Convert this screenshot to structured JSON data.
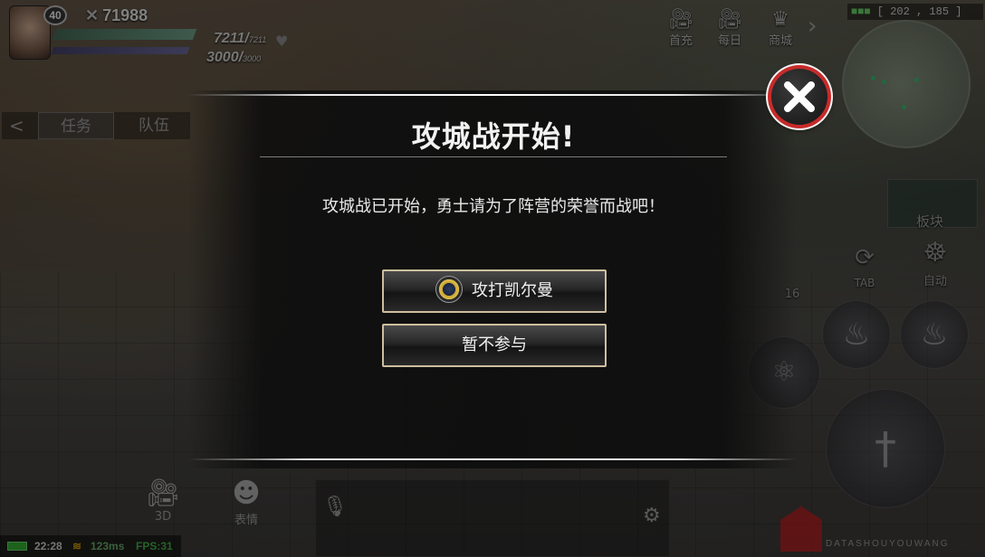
{
  "hud": {
    "level": "40",
    "combat_power": "71988",
    "hp_current": "7211",
    "hp_max": "7211",
    "mp_current": "3000",
    "mp_max": "3000"
  },
  "top_menu": {
    "items": [
      {
        "label": "首充",
        "icon": "camera-icon"
      },
      {
        "label": "每日",
        "icon": "camera-icon"
      },
      {
        "label": "商城",
        "icon": "crown-icon"
      }
    ]
  },
  "minimap": {
    "coordinates": "202 , 185"
  },
  "quest_panel": {
    "tab_task": "任务",
    "tab_team": "队伍"
  },
  "right_panel": {
    "block_label": "板块",
    "tab_label": "TAB",
    "auto_label": "自动",
    "counter": "16"
  },
  "bottom_bar": {
    "camera_label": "3D",
    "emote_label": "表情",
    "time": "22:28",
    "ping": "123ms",
    "fps": "FPS:31"
  },
  "watermark": {
    "text": "DATASHOUYOUWANG"
  },
  "dialog": {
    "title": "攻城战开始!",
    "message": "攻城战已开始，勇士请为了阵营的荣誉而战吧！",
    "attack_button": "攻打凯尔曼",
    "skip_button": "暂不参与"
  },
  "colors": {
    "close_button_ring": "#c72a2a",
    "button_border": "#cdbf9e",
    "dialog_bg": "#0e0e0e"
  }
}
